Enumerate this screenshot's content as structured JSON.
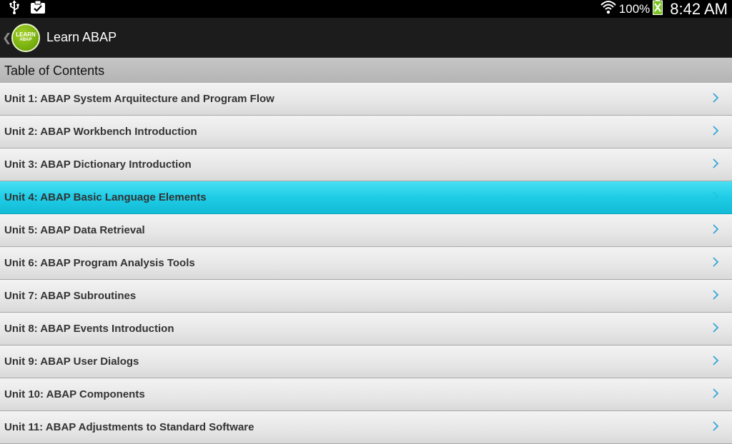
{
  "status_bar": {
    "icons_left": [
      "usb-icon",
      "clipboard-check-icon"
    ],
    "icons_right": [
      "wifi-icon",
      "battery-charging-icon"
    ],
    "battery": "100%",
    "time": "8:42 AM"
  },
  "action_bar": {
    "logo_line1": "LEARN",
    "logo_line2": "ABAP",
    "title": "Learn ABAP"
  },
  "section_header": "Table of Contents",
  "toc": {
    "items": [
      {
        "label": "Unit 1: ABAP System Arquitecture and Program Flow"
      },
      {
        "label": "Unit 2: ABAP Workbench Introduction"
      },
      {
        "label": "Unit 3: ABAP Dictionary Introduction"
      },
      {
        "label": "Unit 4: ABAP Basic Language Elements",
        "selected": true
      },
      {
        "label": "Unit 5: ABAP Data Retrieval"
      },
      {
        "label": "Unit 6: ABAP Program Analysis Tools"
      },
      {
        "label": "Unit 7: ABAP Subroutines"
      },
      {
        "label": "Unit 8: ABAP Events Introduction"
      },
      {
        "label": "Unit 9: ABAP User Dialogs"
      },
      {
        "label": "Unit 10: ABAP Components"
      },
      {
        "label": "Unit 11: ABAP Adjustments to Standard Software"
      }
    ]
  },
  "colors": {
    "selected_row": "#1fcce6",
    "chevron": "#33a6d8",
    "logo_green": "#78b00f"
  }
}
